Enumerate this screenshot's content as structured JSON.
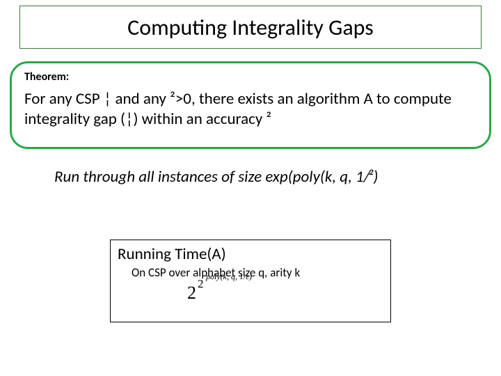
{
  "title": "Computing Integrality Gaps",
  "theorem": {
    "label": "Theorem:",
    "body": "For any CSP ¦ and any ²>0, there exists an algorithm A to compute integrality gap (¦) within an accuracy ²"
  },
  "run_line": "Run through all instances of size exp(poly(k, q, 1/²)",
  "runtime": {
    "head": "Running Time(A)",
    "sub": "On CSP over alphabet size q, arity k",
    "base": "2",
    "exp1": "2",
    "exp2": "poly(k, q, 1/ε)"
  }
}
